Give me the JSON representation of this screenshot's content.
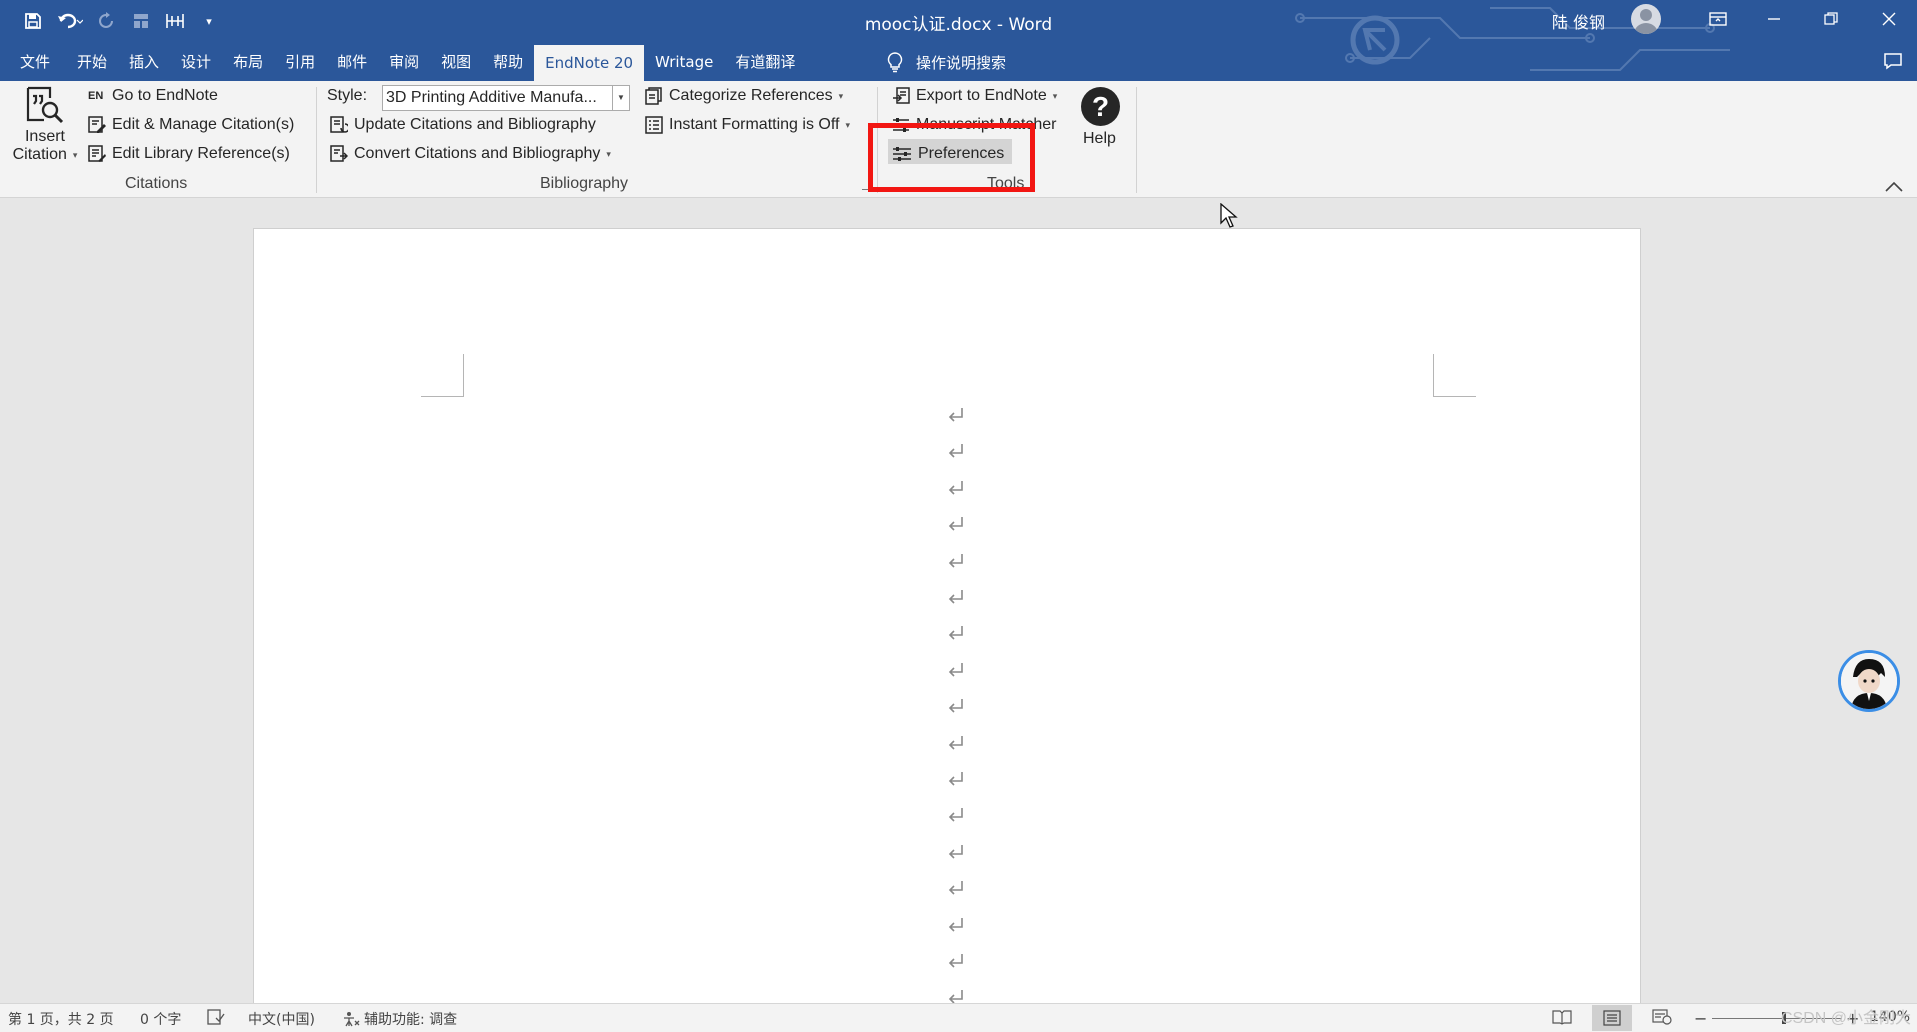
{
  "window": {
    "title": "mooc认证.docx  -  Word",
    "user_name": "陆 俊钢"
  },
  "quick_access": {
    "icons": [
      "save-icon",
      "undo-icon",
      "redo-icon",
      "touch-mode-icon",
      "table-icon",
      "customize-qat-icon"
    ]
  },
  "tabs": [
    {
      "label": "文件"
    },
    {
      "label": "开始"
    },
    {
      "label": "插入"
    },
    {
      "label": "设计"
    },
    {
      "label": "布局"
    },
    {
      "label": "引用"
    },
    {
      "label": "邮件"
    },
    {
      "label": "审阅"
    },
    {
      "label": "视图"
    },
    {
      "label": "帮助"
    },
    {
      "label": "EndNote 20",
      "active": true
    },
    {
      "label": "Writage"
    },
    {
      "label": "有道翻译"
    }
  ],
  "tell_me": "操作说明搜索",
  "ribbon": {
    "citations": {
      "insert_line1": "Insert",
      "insert_line2": "Citation",
      "go_to_badge": "EN",
      "go_to": "Go to EndNote",
      "edit_manage": "Edit & Manage Citation(s)",
      "edit_library": "Edit Library Reference(s)",
      "label": "Citations"
    },
    "bibliography": {
      "style_label": "Style:",
      "style_value": "3D Printing Additive Manufa...",
      "update": "Update Citations and Bibliography",
      "convert": "Convert Citations and Bibliography",
      "categorize": "Categorize References",
      "instant": "Instant Formatting is Off",
      "label": "Bibliography"
    },
    "tools": {
      "export": "Export to EndNote",
      "manuscript": "Manuscript Matcher",
      "preferences": "Preferences",
      "label": "Tools"
    },
    "help": "Help"
  },
  "document": {
    "paragraph_marks": 17,
    "mark_glyph": "↵"
  },
  "status": {
    "page": "第 1 页，共 2 页",
    "words": "0 个字",
    "language": "中文(中国)",
    "accessibility": "辅助功能: 调查",
    "zoom": "140%",
    "watermark": "CSDN @小金刚大"
  },
  "colors": {
    "title_bar": "#2b579a",
    "ribbon": "#f3f3f3",
    "highlight_box": "#f21612",
    "document_bg": "#e6e6e6"
  }
}
